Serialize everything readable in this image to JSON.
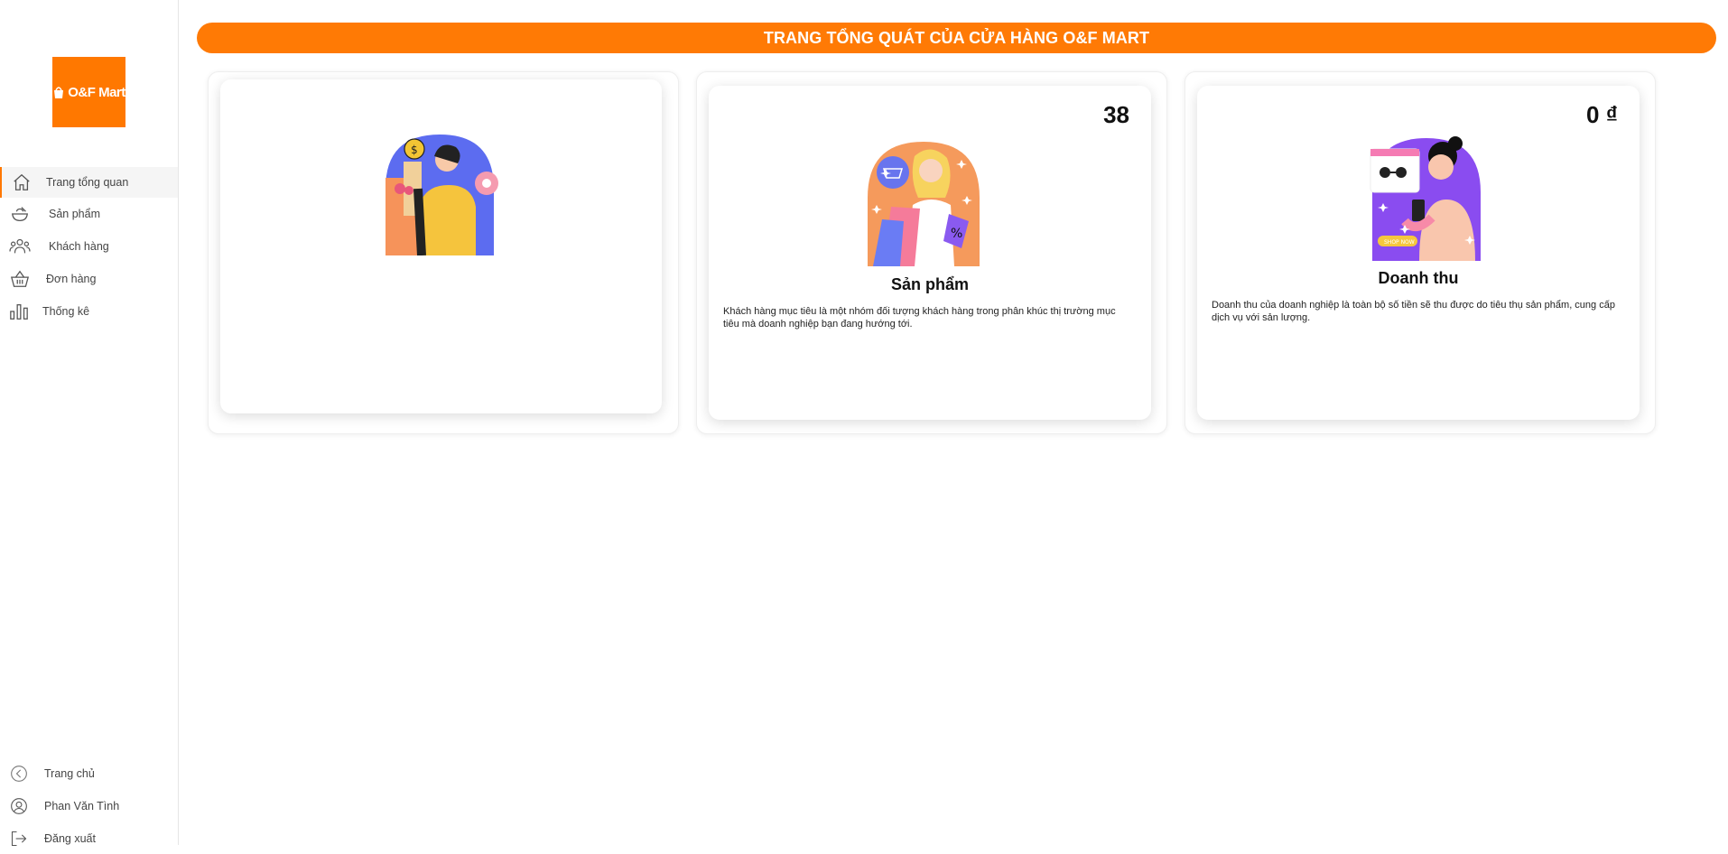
{
  "sidebar": {
    "logo_text": "O&F Mart",
    "items": [
      {
        "label": "Trang tổng quan",
        "icon": "home-icon",
        "active": true
      },
      {
        "label": "Sản phẩm",
        "icon": "bowl-icon"
      },
      {
        "label": "Khách hàng",
        "icon": "users-icon"
      },
      {
        "label": "Đơn hàng",
        "icon": "basket-icon"
      },
      {
        "label": "Thống kê",
        "icon": "bar-chart-icon"
      }
    ],
    "bottom_items": [
      {
        "label": "Trang chủ",
        "icon": "chevron-left-circle-icon"
      },
      {
        "label": "Phan Văn Tình",
        "icon": "user-circle-icon"
      },
      {
        "label": "Đăng xuất",
        "icon": "logout-icon"
      }
    ]
  },
  "header": {
    "title": "TRANG TỔNG QUÁT CỦA CỬA HÀNG O&F MART"
  },
  "cards": [
    {
      "title": "",
      "count": "",
      "description": "",
      "illustration": "shopper-with-bag-illustration",
      "faded": true
    },
    {
      "title": "Sản phẩm",
      "count": "38",
      "description": "Khách hàng mục tiêu là một nhóm đối tượng khách hàng trong phân khúc thị trường mục tiêu mà doanh nghiệp bạn đang hướng tới.",
      "illustration": "shopping-girl-illustration"
    },
    {
      "title": "Doanh thu",
      "count": "0 ₫",
      "description": "Doanh thu của doanh nghiệp là toàn bộ số tiền sẽ thu được do tiêu thụ sản phẩm, cung cấp dịch vụ với sản lượng.",
      "illustration": "online-shopping-woman-illustration"
    }
  ],
  "colors": {
    "accent": "#ff7a05",
    "sidebar_active_bg": "#f5f5f5"
  }
}
